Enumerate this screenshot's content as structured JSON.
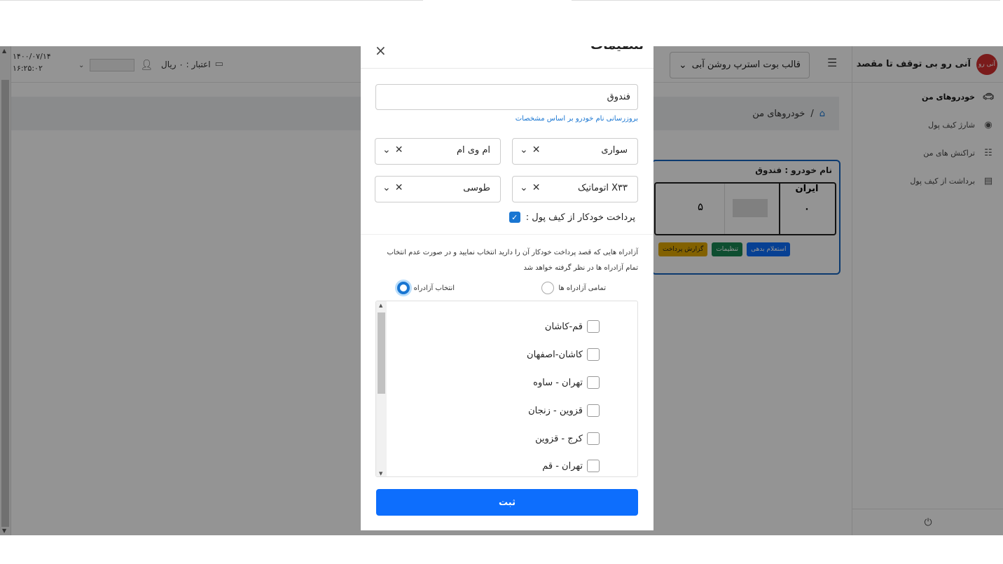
{
  "header": {
    "date": "۱۴۰۰/۰۷/۱۴",
    "time": "۱۶:۲۵:۰۲",
    "credit_label": "اعتبار : ۰ ریال",
    "theme_select_value": "قالب بوت استرپ روشن آبی"
  },
  "sidebar": {
    "brand_title": "آنی رو بی توقف تا مقصد",
    "logo_text": "آنی رو",
    "items": [
      {
        "label": "خودروهای من",
        "icon": "car-icon"
      },
      {
        "label": "شارژ کیف پول",
        "icon": "wallet-icon"
      },
      {
        "label": "تراکنش های من",
        "icon": "list-icon"
      },
      {
        "label": "برداشت از کیف پول",
        "icon": "card-icon"
      }
    ]
  },
  "breadcrumb": {
    "current": "خودروهای من"
  },
  "car_card": {
    "title": "نام خودرو : فندوق",
    "plate_country": "ایران",
    "plate_region": "۰",
    "plate_number": "۵",
    "actions": [
      {
        "label": "استعلام بدهی",
        "color": "#0d6efd"
      },
      {
        "label": "تنظیمات",
        "color": "#198754"
      },
      {
        "label": "گزارش پرداخت",
        "color": "#e0a800"
      }
    ]
  },
  "modal": {
    "title": "تنظیمات",
    "car_name_value": "فندوق",
    "update_name_link": "بروزرسانی نام خودرو بر اساس مشخصات",
    "vehicle_type": "سواری",
    "brand": "ام وی ام",
    "model": "X۳۳ اتوماتیک",
    "color": "طوسی",
    "auto_pay_label": "پرداخت خودکار از کیف پول :",
    "description": "آزادراه هایی که قصد پرداخت خودکار آن را دارید انتخاب نمایید و در صورت عدم انتخاب تمام آزادراه ها در نظر گرفته خواهد شد",
    "radio_all": "تمامی آزادراه ها",
    "radio_select": "انتخاب آزادراه",
    "highways": [
      "قم-کاشان",
      "کاشان-اصفهان",
      "تهران - ساوه",
      "قزوین - زنجان",
      "کرج - قزوین",
      "تهران - قم"
    ],
    "submit_label": "ثبت"
  },
  "colors": {
    "primary": "#0d6efd",
    "accent_blue": "#1976d2",
    "success": "#198754",
    "warning": "#e0a800"
  }
}
